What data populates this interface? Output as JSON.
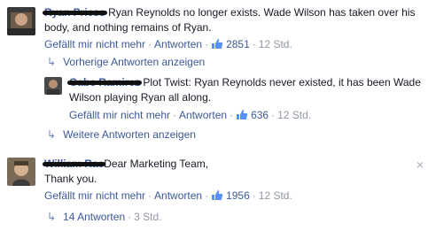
{
  "comments": [
    {
      "author": "Ryan Priess",
      "text": "Ryan Reynolds no longer exists. Wade Wilson has taken over his body, and nothing remains of Ryan.",
      "actions": {
        "like": "Gefällt mir nicht mehr",
        "reply": "Antworten",
        "likes": "2851",
        "time": "12 Std."
      }
    },
    {
      "author": "Gabe Ramirez",
      "text": "Plot Twist: Ryan Reynolds never existed, it has been Wade Wilson playing Ryan all along.",
      "actions": {
        "like": "Gefällt mir nicht mehr",
        "reply": "Antworten",
        "likes": "636",
        "time": "12 Std."
      }
    },
    {
      "author": "William Rae",
      "text_line1": "Dear Marketing Team,",
      "text_line2": "Thank you.",
      "actions": {
        "like": "Gefällt mir nicht mehr",
        "reply": "Antworten",
        "likes": "1956",
        "time": "12 Std."
      }
    }
  ],
  "toggles": {
    "previous": "Vorherige Antworten anzeigen",
    "more": "Weitere Antworten anzeigen",
    "replies_count": "14 Antworten",
    "replies_time": "3 Std."
  },
  "close_symbol": "×",
  "colors": {
    "link": "#3b5998",
    "muted": "#9197a3"
  }
}
